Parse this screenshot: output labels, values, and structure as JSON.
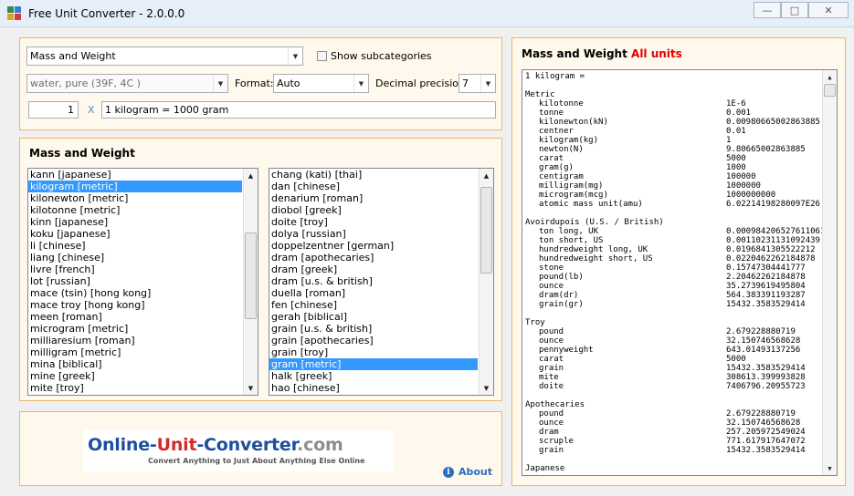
{
  "window": {
    "title": "Free Unit Converter - 2.0.0.0"
  },
  "converter": {
    "category": "Mass and Weight",
    "show_subcategories_label": "Show subcategories",
    "substance": "water, pure (39F, 4C )",
    "format_label": "Format:",
    "format_value": "Auto",
    "precision_label": "Decimal precision:",
    "precision_value": "7",
    "amount": "1",
    "times_sign": "X",
    "conversion_result": "1 kilogram = 1000 gram"
  },
  "units_panel": {
    "title": "Mass and Weight",
    "from_units": [
      "kann [japanese]",
      "kilogram [metric]",
      "kilonewton [metric]",
      "kilotonne [metric]",
      "kinn [japanese]",
      "koku [japanese]",
      "li [chinese]",
      "liang [chinese]",
      "livre [french]",
      "lot [russian]",
      "mace (tsin) [hong kong]",
      "mace troy [hong kong]",
      "meen [roman]",
      "microgram [metric]",
      "milliaresium [roman]",
      "milligram [metric]",
      "mina [biblical]",
      "mine [greek]",
      "mite [troy]"
    ],
    "from_selected": "kilogram [metric]",
    "to_units": [
      "chang (kati) [thai]",
      "dan [chinese]",
      "denarium [roman]",
      "diobol [greek]",
      "doite [troy]",
      "dolya [russian]",
      "doppelzentner [german]",
      "dram [apothecaries]",
      "dram [greek]",
      "dram [u.s. & british]",
      "duella [roman]",
      "fen [chinese]",
      "gerah [biblical]",
      "grain [u.s. & british]",
      "grain [apothecaries]",
      "grain [troy]",
      "gram [metric]",
      "halk [greek]",
      "hao [chinese]"
    ],
    "to_selected": "gram [metric]"
  },
  "ad": {
    "brand_part1": "Online-",
    "brand_part2": "Unit",
    "brand_part3": "-Converter",
    "brand_part4": ".com",
    "tagline": "Convert Anything to Just About Anything Else Online",
    "about_label": "About"
  },
  "results": {
    "title": "Mass and Weight",
    "title_highlight": "All units",
    "header": "1 kilogram =",
    "groups": [
      {
        "name": "Metric",
        "rows": [
          [
            "kilotonne",
            "1E-6"
          ],
          [
            "tonne",
            "0.001"
          ],
          [
            "kilonewton(kN)",
            "0.00980665002863885"
          ],
          [
            "centner",
            "0.01"
          ],
          [
            "kilogram(kg)",
            "1"
          ],
          [
            "newton(N)",
            "9.80665002863885"
          ],
          [
            "carat",
            "5000"
          ],
          [
            "gram(g)",
            "1000"
          ],
          [
            "centigram",
            "100000"
          ],
          [
            "milligram(mg)",
            "1000000"
          ],
          [
            "microgram(mcg)",
            "1000000000"
          ],
          [
            "atomic mass unit(amu)",
            "6.02214198280097E26"
          ]
        ]
      },
      {
        "name": "Avoirdupois (U.S. / British)",
        "rows": [
          [
            "ton long, UK",
            "0.000984206527611061"
          ],
          [
            "ton short, US",
            "0.00110231131092439"
          ],
          [
            "hundredweight long, UK",
            "0.0196841305522212"
          ],
          [
            "hundredweight short, US",
            "0.0220462262184878"
          ],
          [
            "stone",
            "0.15747304441777"
          ],
          [
            "pound(lb)",
            "2.20462262184878"
          ],
          [
            "ounce",
            "35.2739619495804"
          ],
          [
            "dram(dr)",
            "564.383391193287"
          ],
          [
            "grain(gr)",
            "15432.3583529414"
          ]
        ]
      },
      {
        "name": "Troy",
        "rows": [
          [
            "pound",
            "2.679228880719"
          ],
          [
            "ounce",
            "32.150746568628"
          ],
          [
            "pennyweight",
            "643.01493137256"
          ],
          [
            "carat",
            "5000"
          ],
          [
            "grain",
            "15432.3583529414"
          ],
          [
            "mite",
            "308613.399993828"
          ],
          [
            "doite",
            "7406796.20955723"
          ]
        ]
      },
      {
        "name": "Apothecaries",
        "rows": [
          [
            "pound",
            "2.679228880719"
          ],
          [
            "ounce",
            "32.150746568628"
          ],
          [
            "dram",
            "257.205972549024"
          ],
          [
            "scruple",
            "771.617917647072"
          ],
          [
            "grain",
            "15432.3583529414"
          ]
        ]
      },
      {
        "name": "Japanese",
        "rows": []
      }
    ]
  }
}
